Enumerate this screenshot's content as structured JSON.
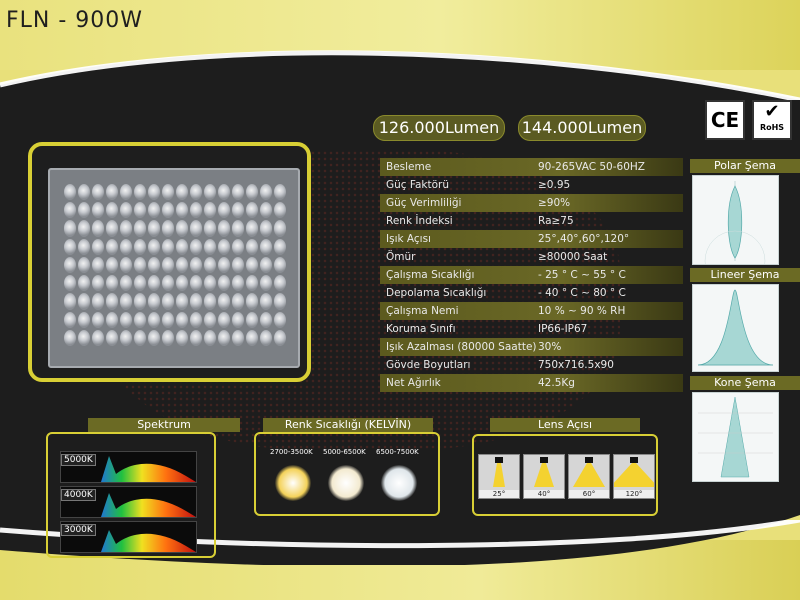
{
  "title": "FLN - 900W",
  "lumens": [
    "126.000Lumen",
    "144.000Lumen"
  ],
  "certs": {
    "ce": "CE",
    "rohs": "RoHS"
  },
  "specs": [
    {
      "k": "Besleme",
      "v": "90-265VAC 50-60HZ",
      "shaded": true
    },
    {
      "k": "Güç Faktörü",
      "v": "≥0.95",
      "shaded": false
    },
    {
      "k": "Güç Verimliliği",
      "v": "≥90%",
      "shaded": true
    },
    {
      "k": "Renk İndeksi",
      "v": "Ra≥75",
      "shaded": false
    },
    {
      "k": "Işık Açısı",
      "v": "25°,40°,60°,120°",
      "shaded": true
    },
    {
      "k": "Ömür",
      "v": "≥80000 Saat",
      "shaded": false
    },
    {
      "k": "Çalışma Sıcaklığı",
      "v": "- 25 ° C ~ 55 ° C",
      "shaded": true
    },
    {
      "k": "Depolama Sıcaklığı",
      "v": "- 40 ° C ~ 80 ° C",
      "shaded": false
    },
    {
      "k": "Çalışma Nemi",
      "v": "10 % ~ 90 % RH",
      "shaded": true
    },
    {
      "k": "Koruma Sınıfı",
      "v": "IP66-IP67",
      "shaded": false
    },
    {
      "k": "Işık Azalması (80000 Saatte)",
      "v": "30%",
      "shaded": true
    },
    {
      "k": "Gövde Boyutları",
      "v": "750x716.5x90",
      "shaded": false
    },
    {
      "k": "Net Ağırlık",
      "v": "42.5Kg",
      "shaded": true
    }
  ],
  "diagrams": {
    "polar": "Polar Şema",
    "linear": "Lineer Şema",
    "cone": "Kone Şema"
  },
  "spectrum": {
    "label": "Spektrum",
    "temps": [
      "5000K",
      "4000K",
      "3000K"
    ]
  },
  "kelvin": {
    "label": "Renk Sıcaklığı (KELVİN)",
    "ranges": [
      "2700-3500K",
      "5000-6500K",
      "6500-7500K"
    ],
    "colors": [
      "#f4d25a",
      "#f3ead0",
      "#dfe6ea"
    ]
  },
  "lens": {
    "label": "Lens Açısı",
    "angles": [
      "25°",
      "40°",
      "60°",
      "120°"
    ]
  },
  "colors": {
    "accent": "#d8cf35",
    "panel": "#1d1d1d",
    "band": "#e8e07a"
  }
}
